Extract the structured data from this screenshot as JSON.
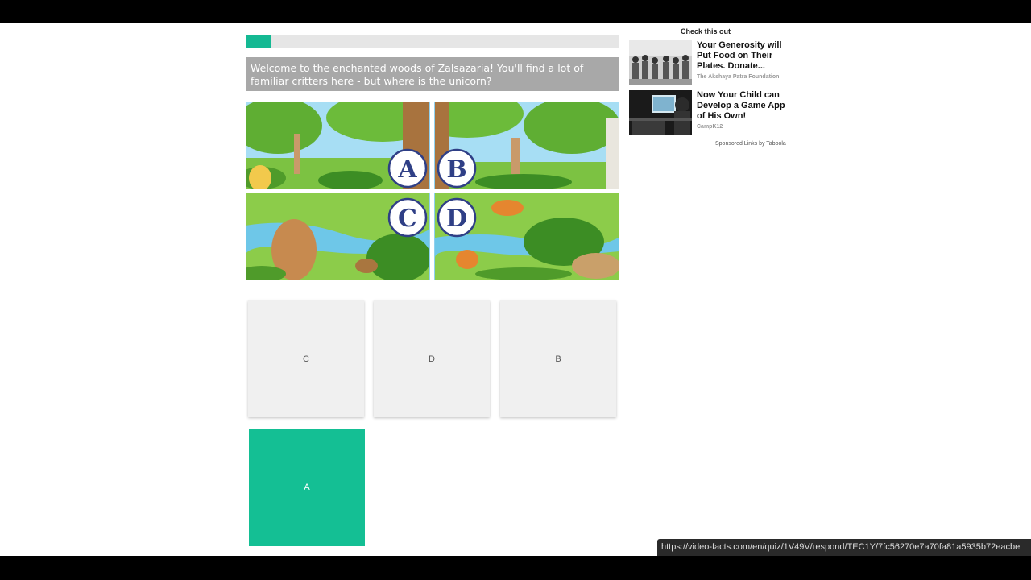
{
  "quiz": {
    "progress": 0.07,
    "question": "Welcome to the enchanted woods of Zalsazaria! You'll find a lot of familiar critters here - but where is the unicorn?",
    "scene_labels": [
      "A",
      "B",
      "C",
      "D"
    ],
    "answers": [
      {
        "label": "C",
        "selected": false
      },
      {
        "label": "D",
        "selected": false
      },
      {
        "label": "B",
        "selected": false
      },
      {
        "label": "A",
        "selected": true
      }
    ],
    "accent_color": "#14bf94"
  },
  "sponsored": {
    "heading": "Check this out",
    "ads": [
      {
        "title": "Your Generosity will Put Food on Their Plates. Donate...",
        "source": "The Akshaya Patra Foundation"
      },
      {
        "title": "Now Your Child can Develop a Game App of His Own!",
        "source": "CampK12"
      }
    ],
    "footer": "Sponsored Links by Taboola"
  },
  "status_bar": {
    "url": "https://video-facts.com/en/quiz/1V49V/respond/TEC1Y/7fc56270e7a70fa81a5935b72eacbe"
  }
}
